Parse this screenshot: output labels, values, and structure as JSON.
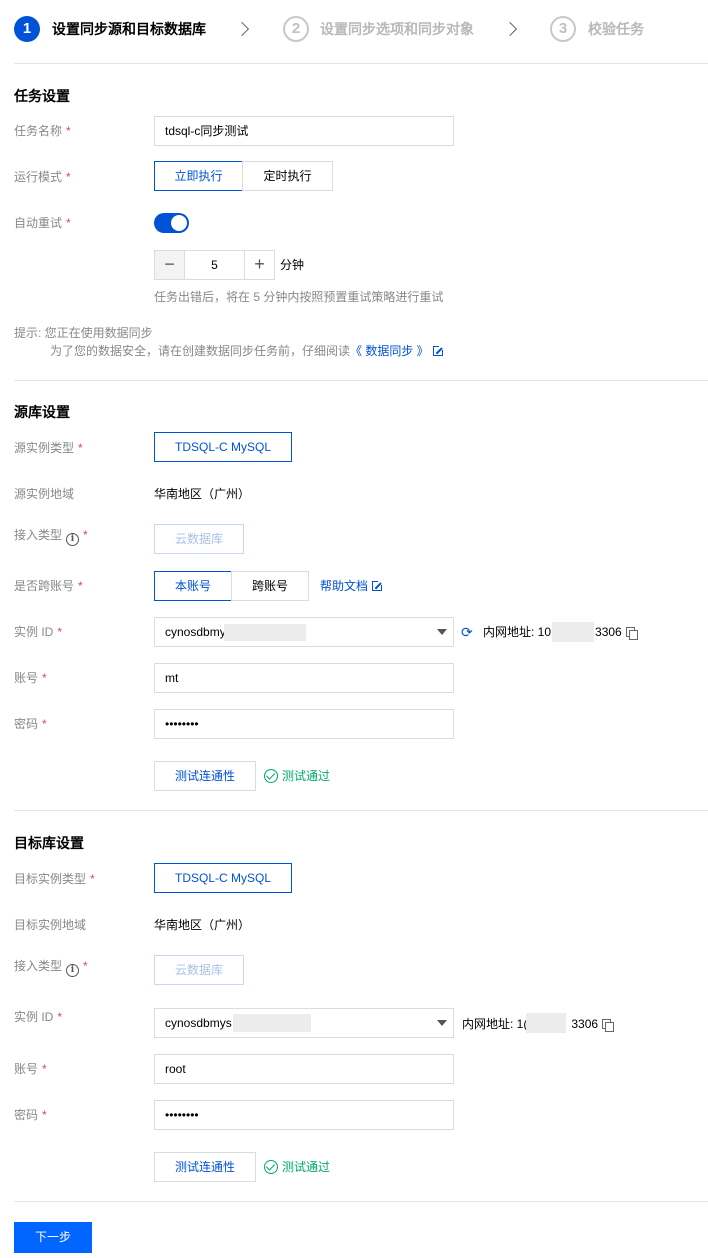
{
  "steps": [
    {
      "number": "1",
      "label": "设置同步源和目标数据库"
    },
    {
      "number": "2",
      "label": "设置同步选项和同步对象"
    },
    {
      "number": "3",
      "label": "校验任务"
    }
  ],
  "task": {
    "section_title": "任务设置",
    "name_label": "任务名称",
    "name_value": "tdsql-c同步测试",
    "mode_label": "运行模式",
    "mode_options": [
      "立即执行",
      "定时执行"
    ],
    "retry_label": "自动重试",
    "retry_enabled": true,
    "retry_minutes": "5",
    "retry_unit": "分钟",
    "retry_hint": "任务出错后，将在 5 分钟内按照预置重试策略进行重试",
    "tip_prefix": "提示:  您正在使用数据同步",
    "tip_line2": "为了您的数据安全，请在创建数据同步任务前，仔细阅读",
    "tip_link": "《 数据同步 》"
  },
  "source": {
    "section_title": "源库设置",
    "type_label": "源实例类型",
    "type_value": "TDSQL-C MySQL",
    "region_label": "源实例地域",
    "region_value": "华南地区（广州）",
    "access_label": "接入类型",
    "access_value": "云数据库",
    "cross_label": "是否跨账号",
    "cross_options": [
      "本账号",
      "跨账号"
    ],
    "help_link": "帮助文档",
    "instance_label": "实例 ID",
    "instance_value": "cynosdbmy",
    "intranet_prefix": "内网地址: 10",
    "intranet_suffix": "3306",
    "account_label": "账号",
    "account_value": "mt",
    "password_label": "密码",
    "password_value": "••••••••",
    "test_button": "测试连通性",
    "test_result": "测试通过"
  },
  "target": {
    "section_title": "目标库设置",
    "type_label": "目标实例类型",
    "type_value": "TDSQL-C MySQL",
    "region_label": "目标实例地域",
    "region_value": "华南地区（广州）",
    "access_label": "接入类型",
    "access_value": "云数据库",
    "instance_label": "实例 ID",
    "instance_value": "cynosdbmys",
    "intranet_prefix": "内网地址: 1(",
    "intranet_suffix": "3306",
    "account_label": "账号",
    "account_value": "root",
    "password_label": "密码",
    "password_value": "••••••••",
    "test_button": "测试连通性",
    "test_result": "测试通过"
  },
  "footer": {
    "next_button": "下一步"
  },
  "colors": {
    "primary": "#0052d9",
    "success": "#00a870",
    "required": "#e54545"
  }
}
